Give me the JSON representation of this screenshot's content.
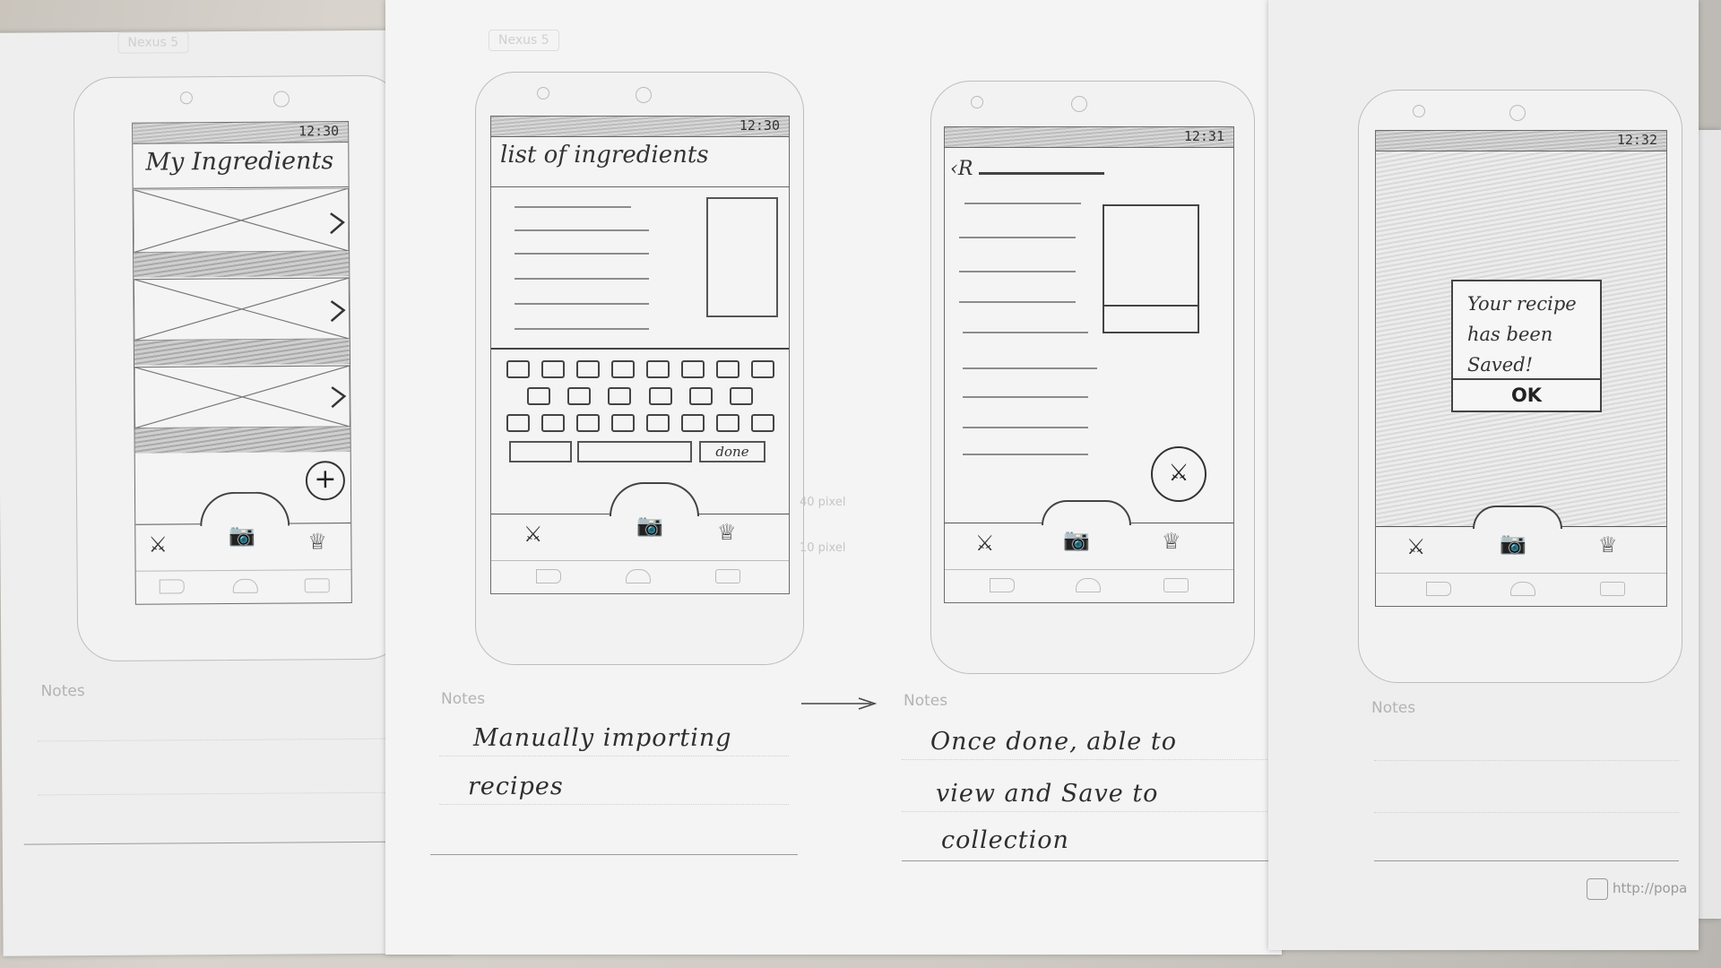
{
  "frame_tag": "Nexus 5",
  "notes_label": "Notes",
  "screens": [
    {
      "clock": "12:30",
      "title": "My Ingredients",
      "fab_symbol": "+"
    },
    {
      "clock": "12:30",
      "title": "list of ingredients",
      "done_label": "done",
      "measure_top": "40 pixel",
      "measure_bottom": "10 pixel"
    },
    {
      "clock": "12:31",
      "back_mark": "R"
    },
    {
      "clock": "12:32",
      "dialog_text": "Your recipe has been Saved!",
      "dialog_ok": "OK"
    }
  ],
  "notes": {
    "screen2_line1": "Manually importing",
    "screen2_line2": "recipes",
    "screen3_line1": "Once done, able to",
    "screen3_line2": "view and Save to",
    "screen3_line3": "collection"
  },
  "footer_url": "http://popa",
  "icons": [
    "fork-knife-icon",
    "camera-icon",
    "chef-hat-icon",
    "back-nav-icon",
    "home-nav-icon",
    "recents-nav-icon",
    "arrow-icon",
    "chevron-right-icon"
  ]
}
